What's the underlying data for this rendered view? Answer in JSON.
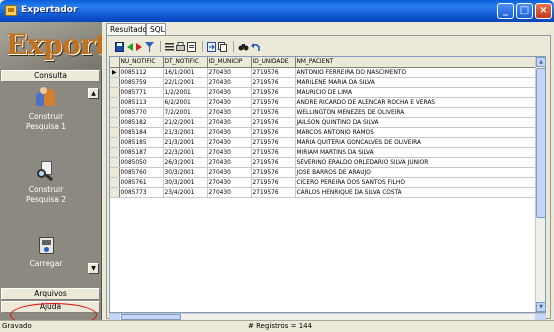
{
  "window": {
    "title": "Expertador"
  },
  "logo": {
    "text": "Exportador"
  },
  "sidebar": {
    "consulta_label": "Consulta",
    "tools": [
      {
        "icon": "people-icon",
        "label_line1": "Construir",
        "label_line2": "Pesquisa 1"
      },
      {
        "icon": "search-document-icon",
        "label_line1": "Construir",
        "label_line2": "Pesquisa 2"
      },
      {
        "icon": "load-icon",
        "label_line1": "Carregar",
        "label_line2": ""
      }
    ],
    "arquivos_label": "Arquivos",
    "ajuda_label": "Ajuda"
  },
  "tabs": [
    {
      "label": "Resultado",
      "active": true
    },
    {
      "label": "SQL",
      "active": false
    }
  ],
  "grid": {
    "columns": [
      "NU_NOTIFIC",
      "DT_NOTIFIC",
      "ID_MUNICIP",
      "ID_UNIDADE",
      "NM_PACIENT"
    ],
    "rows": [
      [
        "0085112",
        "16/1/2001",
        "270430",
        "2719576",
        "ANTONIO FERREIRA DO NASCIMENTO"
      ],
      [
        "0085759",
        "22/1/2001",
        "270430",
        "2719576",
        "MARILENE MARIA DA SILVA"
      ],
      [
        "0085771",
        "1/2/2001",
        "270430",
        "2719576",
        "MAURICIO DE LIMA"
      ],
      [
        "0085113",
        "6/2/2001",
        "270430",
        "2719576",
        "ANDRE RICARDO DE ALENCAR ROCHA E VERAS"
      ],
      [
        "0085770",
        "7/2/2001",
        "270430",
        "2719576",
        "WELLINGTON MENEZES DE OLIVEIRA"
      ],
      [
        "0085182",
        "21/2/2001",
        "270430",
        "2719576",
        "JAILSON QUINTINO DA SILVA"
      ],
      [
        "0085184",
        "21/3/2001",
        "270430",
        "2719576",
        "MARCOS ANTONIO RAMOS"
      ],
      [
        "0085185",
        "21/3/2001",
        "270430",
        "2719576",
        "MARIA QUITERIA GONCALVES DE OLIVEIRA"
      ],
      [
        "0085187",
        "22/3/2001",
        "270430",
        "2719576",
        "MIRIAM MARTINS DA SILVA"
      ],
      [
        "0085050",
        "26/3/2001",
        "270430",
        "2719576",
        "SEVERINO ERALDO ORLEDARIO SILVA JUNIOR"
      ],
      [
        "0085760",
        "30/3/2001",
        "270430",
        "2719576",
        "JOSE BARROS DE ARAUJO"
      ],
      [
        "0085761",
        "30/3/2001",
        "270430",
        "2719576",
        "CICERO PEREIRA DOS SANTOS FILHO"
      ],
      [
        "0085773",
        "23/4/2001",
        "270430",
        "2719576",
        "CARLOS HENRIQUE DA SILVA COSTA"
      ]
    ]
  },
  "status": {
    "left": "Gravado",
    "records": "# Registros = 144"
  }
}
